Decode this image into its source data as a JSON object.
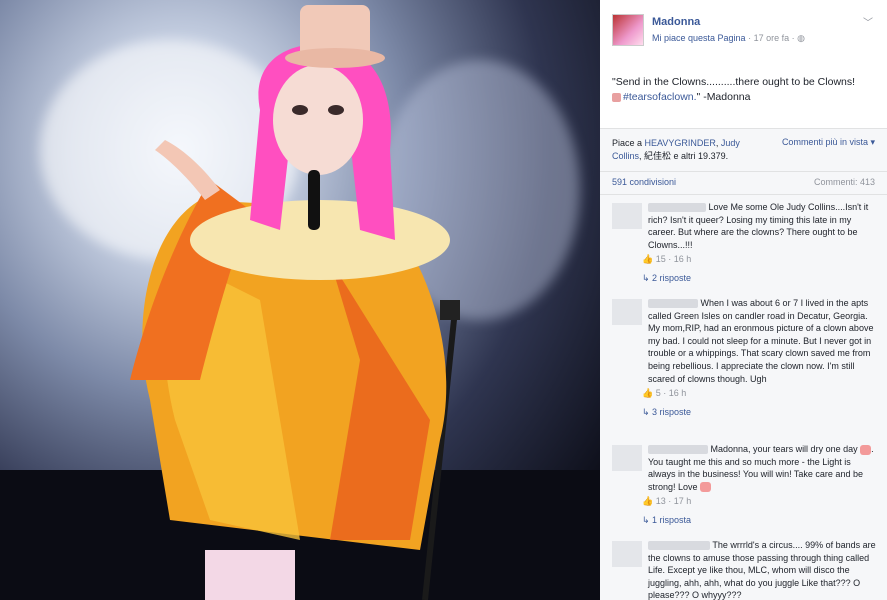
{
  "post": {
    "page_name": "Madonna",
    "like_page": "Mi piace questa Pagina",
    "time": "17 ore fa",
    "privacy_icon": "globe-icon",
    "text_line1": "\"Send in the Clowns..........there ought to be Clowns!",
    "hashtag": "#tearsofaclown.",
    "text_after": "\" -Madonna"
  },
  "likes": {
    "prefix": "Piace a ",
    "name1": "HEAVYGRINDER",
    "sep1": ", ",
    "name2": "Judy Collins",
    "sep2": ", ",
    "name3": "紀佳松",
    "suffix": " e altri 19.379.",
    "sort_label": "Commenti più in vista ▾"
  },
  "stats": {
    "shares": "591 condivisioni",
    "comments": "Commenti: 413"
  },
  "comments": [
    {
      "text": "Love Me some Ole Judy Collins....Isn't it rich? Isn't it queer? Losing my timing this late in my career. But where are the clowns? There ought to be Clowns...!!!",
      "likes": "15",
      "time": "16 h",
      "replies": "2 risposte"
    },
    {
      "text": "When I was about 6 or 7 I lived in the apts called Green Isles on candler road in Decatur, Georgia. My mom,RIP, had an eronmous picture of a clown above my bad. I could not sleep for a minute. But I never got in trouble or a whippings. That scary clown saved me from being rebellious. I appreciate the clown now. I'm still scared of clowns though. Ugh",
      "likes": "5",
      "time": "16 h",
      "replies": "3 risposte"
    },
    {
      "text_a": "Madonna, your tears will dry one day",
      "text_b": ". You taught me this and so much more - the Light is always in the business! You will win! Take care and be strong! Love",
      "likes": "13",
      "time": "17 h",
      "replies": "1 risposta"
    },
    {
      "text": "The wrrrld's a circus.... 99% of bands are the clowns to amuse those passing through thing called Life. Except ye like thou, MLC, whom will disco the juggling, ahh, ahh, what do you juggle Like that??? O please??? O whyyy???"
    }
  ],
  "colors": {
    "link": "#3b5998",
    "meta": "#90949c",
    "wig": "#ff5fc8",
    "costume": "#f5a020"
  }
}
